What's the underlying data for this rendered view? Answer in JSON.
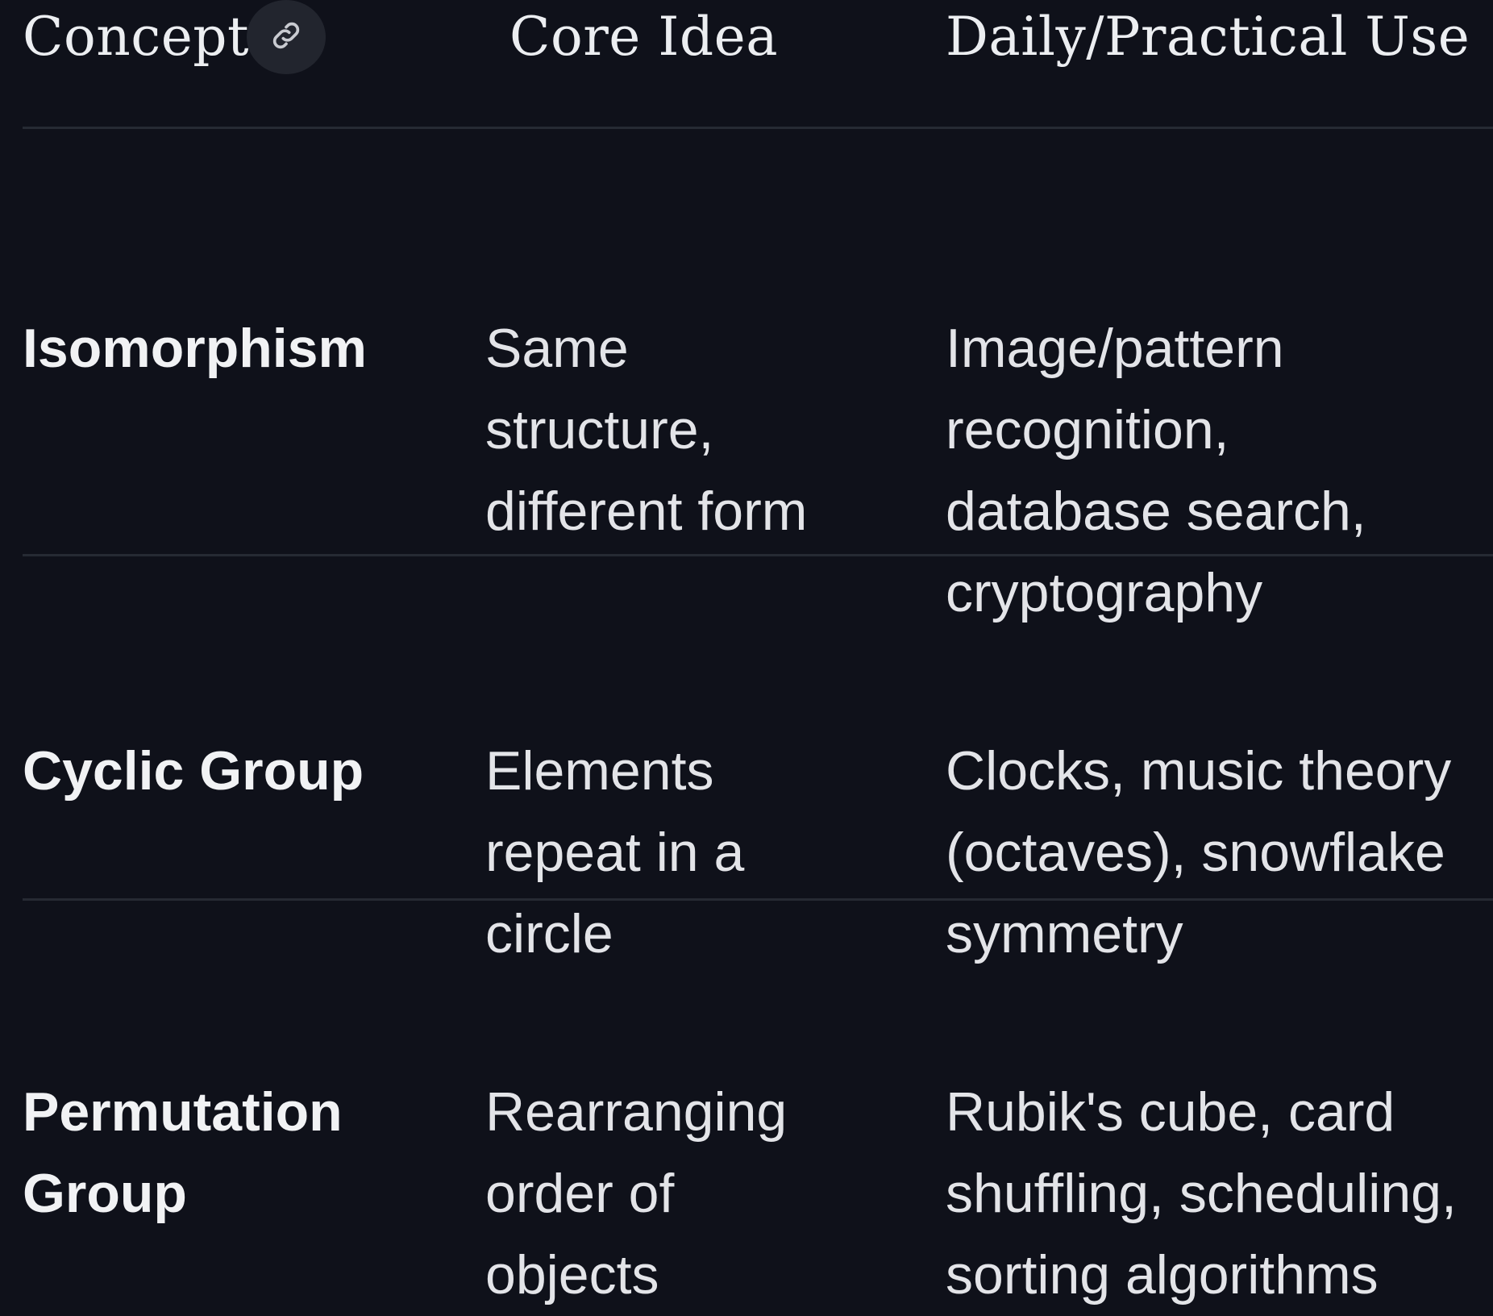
{
  "table": {
    "headers": {
      "concept": "Concept",
      "core_idea": "Core Idea",
      "use": "Daily/Practical Use"
    },
    "link_icon": "link-icon",
    "rows": [
      {
        "concept": [
          "Isomorphism"
        ],
        "core_idea": [
          "Same",
          "structure,",
          "different form"
        ],
        "use": [
          "Image/pattern",
          "recognition,",
          "database search,",
          "cryptography"
        ]
      },
      {
        "concept": [
          "Cyclic Group"
        ],
        "core_idea": [
          "Elements",
          "repeat in a",
          "circle"
        ],
        "use": [
          "Clocks, music theory",
          "(octaves), snowflake",
          "symmetry"
        ]
      },
      {
        "concept": [
          "Permutation",
          "Group"
        ],
        "core_idea": [
          "Rearranging",
          "order of",
          "objects"
        ],
        "use": [
          "Rubik's cube, card",
          "shuffling, scheduling,",
          "sorting algorithms"
        ]
      }
    ]
  },
  "colors": {
    "background": "#0f111a",
    "divider": "#262a33",
    "text": "#e3e4e8",
    "link_button_bg": "#22252e"
  }
}
